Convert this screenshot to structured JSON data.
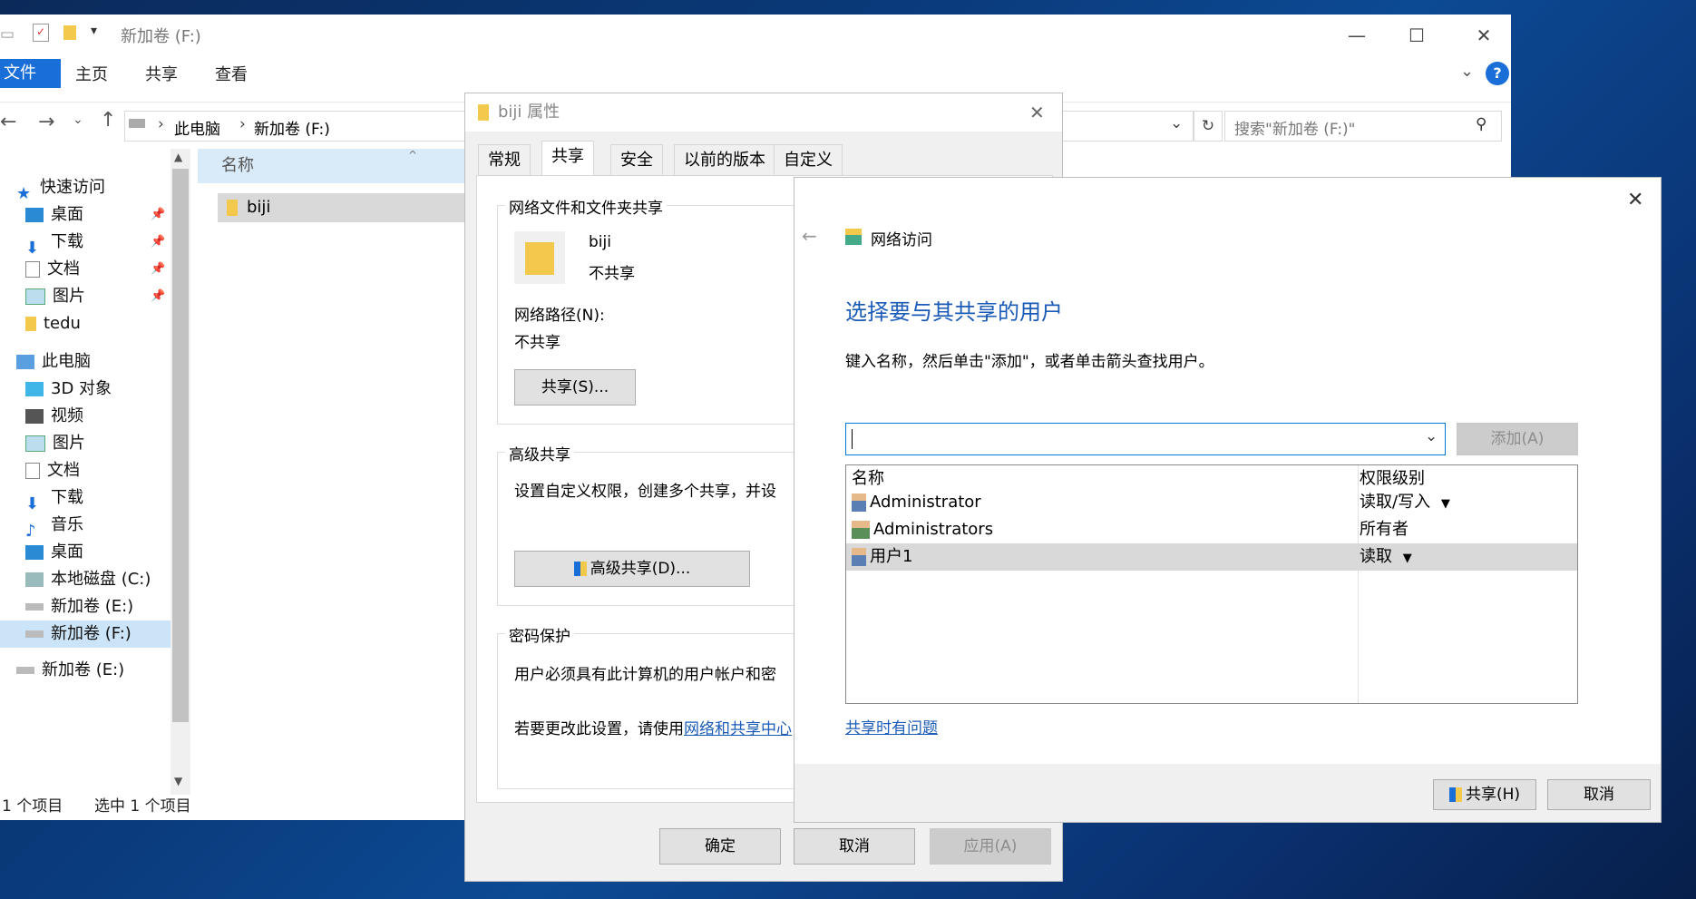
{
  "explorer": {
    "title": "新加卷 (F:)",
    "ribbon_tabs": {
      "file": "文件",
      "home": "主页",
      "share": "共享",
      "view": "查看"
    },
    "address": {
      "this_pc": "此电脑",
      "current": "新加卷 (F:)"
    },
    "search_placeholder": "搜索\"新加卷 (F:)\"",
    "nav": {
      "quick_access": "快速访问",
      "desktop": "桌面",
      "downloads": "下载",
      "documents": "文档",
      "pictures": "图片",
      "tedu": "tedu",
      "this_pc": "此电脑",
      "objects_3d": "3D 对象",
      "videos": "视频",
      "pictures2": "图片",
      "documents2": "文档",
      "downloads2": "下载",
      "music": "音乐",
      "desktop2": "桌面",
      "local_c": "本地磁盘 (C:)",
      "vol_e": "新加卷 (E:)",
      "vol_f": "新加卷 (F:)",
      "vol_e2": "新加卷 (E:)"
    },
    "column_name": "名称",
    "files": [
      "biji"
    ],
    "status": {
      "count": "1 个项目",
      "selected": "选中 1 个项目"
    }
  },
  "props": {
    "title": "biji 属性",
    "tabs": [
      "常规",
      "共享",
      "安全",
      "以前的版本",
      "自定义"
    ],
    "net_share_group": "网络文件和文件夹共享",
    "folder_name": "biji",
    "folder_state": "不共享",
    "net_path_label": "网络路径(N):",
    "net_path_value": "不共享",
    "share_btn": "共享(S)...",
    "adv_group": "高级共享",
    "adv_desc": "设置自定义权限，创建多个共享，并设",
    "adv_btn": "高级共享(D)...",
    "pwd_group": "密码保护",
    "pwd_desc": "用户必须具有此计算机的用户帐户和密",
    "pwd_change_prefix": "若要更改此设置，请使用",
    "pwd_change_link": "网络和共享中心",
    "ok": "确定",
    "cancel": "取消",
    "apply": "应用(A)"
  },
  "netaccess": {
    "title": "网络访问",
    "heading": "选择要与其共享的用户",
    "desc": "键入名称，然后单击\"添加\"，或者单击箭头查找用户。",
    "input_value": "",
    "add_btn": "添加(A)",
    "col_name": "名称",
    "col_perm": "权限级别",
    "users": [
      {
        "name": "Administrator",
        "perm": "读取/写入"
      },
      {
        "name": "Administrators",
        "perm": "所有者"
      },
      {
        "name": "用户1",
        "perm": "读取"
      }
    ],
    "trouble_link": "共享时有问题",
    "share_btn": "共享(H)",
    "cancel_btn": "取消"
  }
}
